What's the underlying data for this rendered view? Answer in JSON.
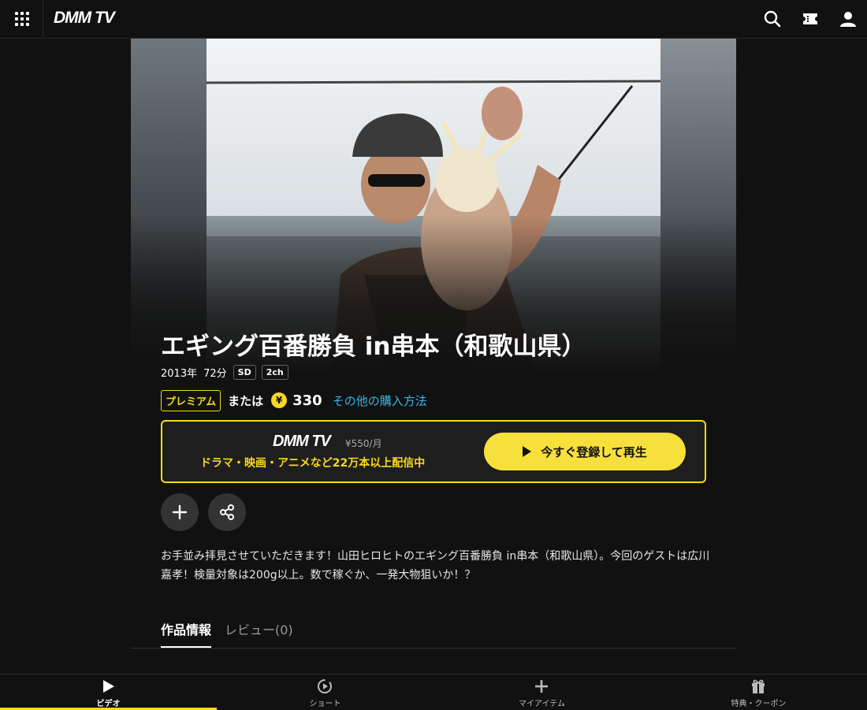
{
  "header": {
    "logo": "DMM TV",
    "icons": [
      "apps-grid-icon",
      "search-icon",
      "ticket-icon",
      "user-icon"
    ]
  },
  "hero": {
    "image_alt": "fishing-photo"
  },
  "title": "エギング百番勝負 in串本（和歌山県）",
  "meta": {
    "year": "2013年",
    "duration": "72分",
    "tags": [
      "SD",
      "2ch"
    ]
  },
  "pricing": {
    "premium_label": "プレミアム",
    "or_label": "または",
    "yen_symbol": "¥",
    "price": "330",
    "other_purchase_link": "その他の購入方法"
  },
  "promo": {
    "logo": "DMM TV",
    "monthly_price": "¥550/月",
    "tagline": "ドラマ・映画・アニメなど22万本以上配信中",
    "cta_label": "今すぐ登録して再生"
  },
  "actions": [
    "add-to-list-icon",
    "share-icon"
  ],
  "description": "お手並み拝見させていただきます！山田ヒロヒトのエギング百番勝負 in串本（和歌山県）。今回のゲストは広川嘉孝！検量対象は200g以上。数で稼ぐか、一発大物狙いか！？",
  "tabs": [
    {
      "label": "作品情報",
      "active": true
    },
    {
      "label": "レビュー(0)",
      "active": false
    }
  ],
  "bottom_nav": [
    {
      "label": "ビデオ",
      "icon": "play-icon",
      "active": true
    },
    {
      "label": "ショート",
      "icon": "shorts-icon",
      "active": false
    },
    {
      "label": "マイアイテム",
      "icon": "plus-icon",
      "active": false
    },
    {
      "label": "特典・クーポン",
      "icon": "gift-icon",
      "active": false
    }
  ],
  "colors": {
    "background": "#111111",
    "accent": "#f8d81f",
    "link": "#3cb4e6"
  }
}
